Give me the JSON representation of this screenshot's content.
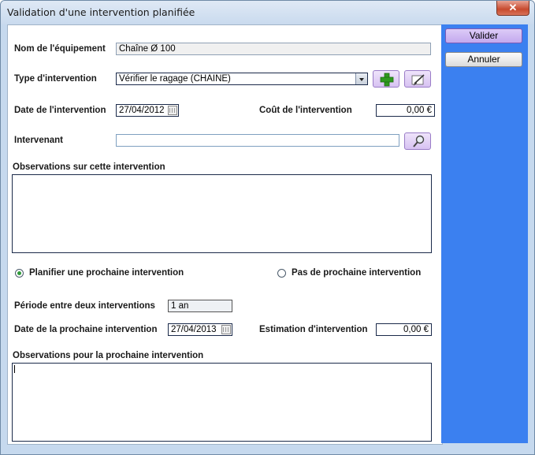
{
  "window": {
    "title": "Validation d'une intervention planifiée",
    "close_glyph": "✕"
  },
  "form": {
    "equipment": {
      "label": "Nom de l'équipement",
      "value": "Chaîne Ø 100"
    },
    "type": {
      "label": "Type d'intervention",
      "value": "Vérifier le ragage (CHAINE)"
    },
    "date": {
      "label": "Date de l'intervention",
      "value": "27/04/2012"
    },
    "cost": {
      "label": "Coût de l'intervention",
      "value": "0,00 €"
    },
    "worker": {
      "label": "Intervenant",
      "value": ""
    },
    "observations": {
      "label": "Observations sur cette intervention",
      "value": ""
    },
    "plan_next": {
      "label": "Planifier une prochaine intervention",
      "checked": true
    },
    "no_next": {
      "label": "Pas de prochaine intervention",
      "checked": false
    },
    "period": {
      "label": "Période entre deux interventions",
      "value": "1 an"
    },
    "next_date": {
      "label": "Date de la prochaine intervention",
      "value": "27/04/2013"
    },
    "estimate": {
      "label": "Estimation d'intervention",
      "value": "0,00 €"
    },
    "next_observations": {
      "label": "Observations pour la prochaine intervention",
      "value": ""
    }
  },
  "actions": {
    "validate_label": "Valider",
    "cancel_label": "Annuler"
  },
  "icons": {
    "add": "plus-icon",
    "edit": "edit-icon",
    "search": "search-icon"
  },
  "colors": {
    "panel": "#3b80f0",
    "primary_button": "#c4a9ee",
    "radio_checked": "#2f9a3a"
  }
}
